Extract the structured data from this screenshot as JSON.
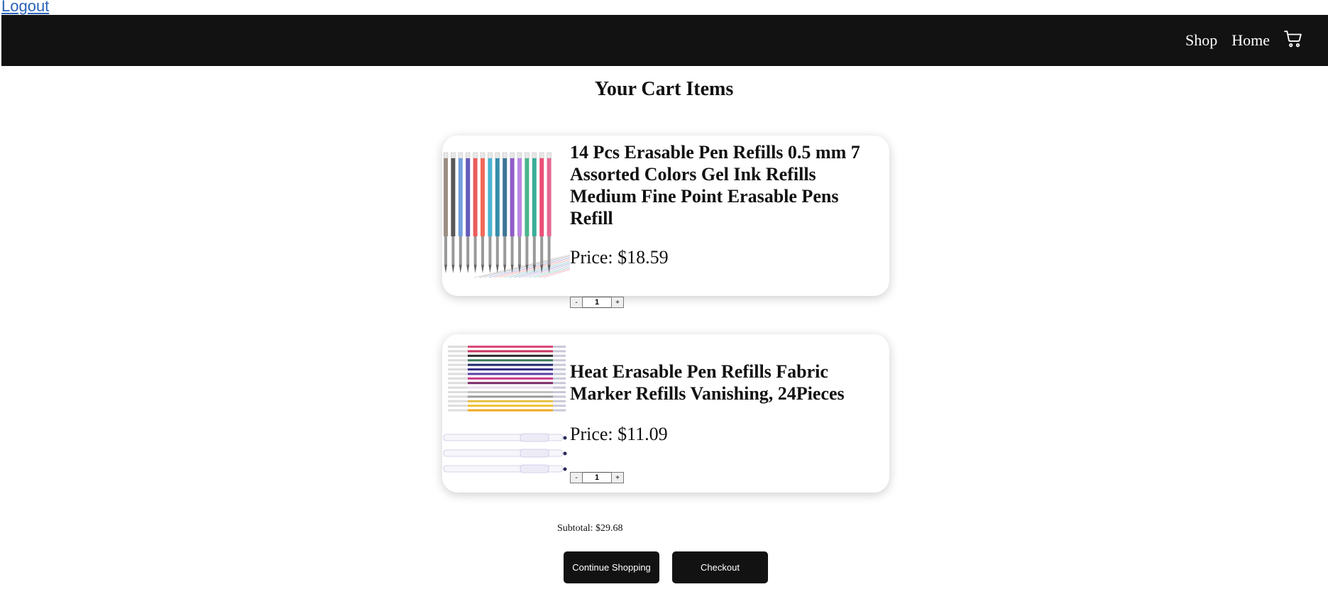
{
  "header": {
    "logout_label": "Logout",
    "nav": [
      {
        "label": "Shop"
      },
      {
        "label": "Home"
      }
    ],
    "cart_icon": "cart-icon",
    "background_color": "#121212"
  },
  "page": {
    "title": "Your Cart Items"
  },
  "cart": {
    "items": [
      {
        "name": "14 Pcs Erasable Pen Refills 0.5 mm 7 Assorted Colors Gel Ink Refills Medium Fine Point Erasable Pens Refill",
        "price": "Price: $18.59",
        "quantity": "1",
        "decrement_label": "-",
        "increment_label": "+",
        "refill_colors": [
          "#8b7b6e",
          "#3a3a3a",
          "#5a8fd8",
          "#4a3fb0",
          "#e84040",
          "#f0503c",
          "#2aa8c8",
          "#137a9c",
          "#1a5c84",
          "#7b3fbf",
          "#b070e0",
          "#2aa878",
          "#18a088",
          "#e83060",
          "#e05080"
        ]
      },
      {
        "name": "Heat Erasable Pen Refills Fabric Marker Refills Vanishing, 24Pieces",
        "price": "Price: $11.09",
        "quantity": "1",
        "decrement_label": "-",
        "increment_label": "+",
        "refill_colors": [
          "#d84a78",
          "#c8355f",
          "#2a2a2a",
          "#3a7a5a",
          "#1e2a6a",
          "#3a2f88",
          "#5a3fa8",
          "#c83a88",
          "#7a2a68",
          "#e8e0f0",
          "#c0c0c0",
          "#9a9a9a",
          "#e8c040",
          "#f0c030",
          "#f0a820"
        ]
      }
    ],
    "subtotal": "Subtotal: $29.68",
    "continue_label": "Continue Shopping",
    "checkout_label": "Checkout"
  }
}
